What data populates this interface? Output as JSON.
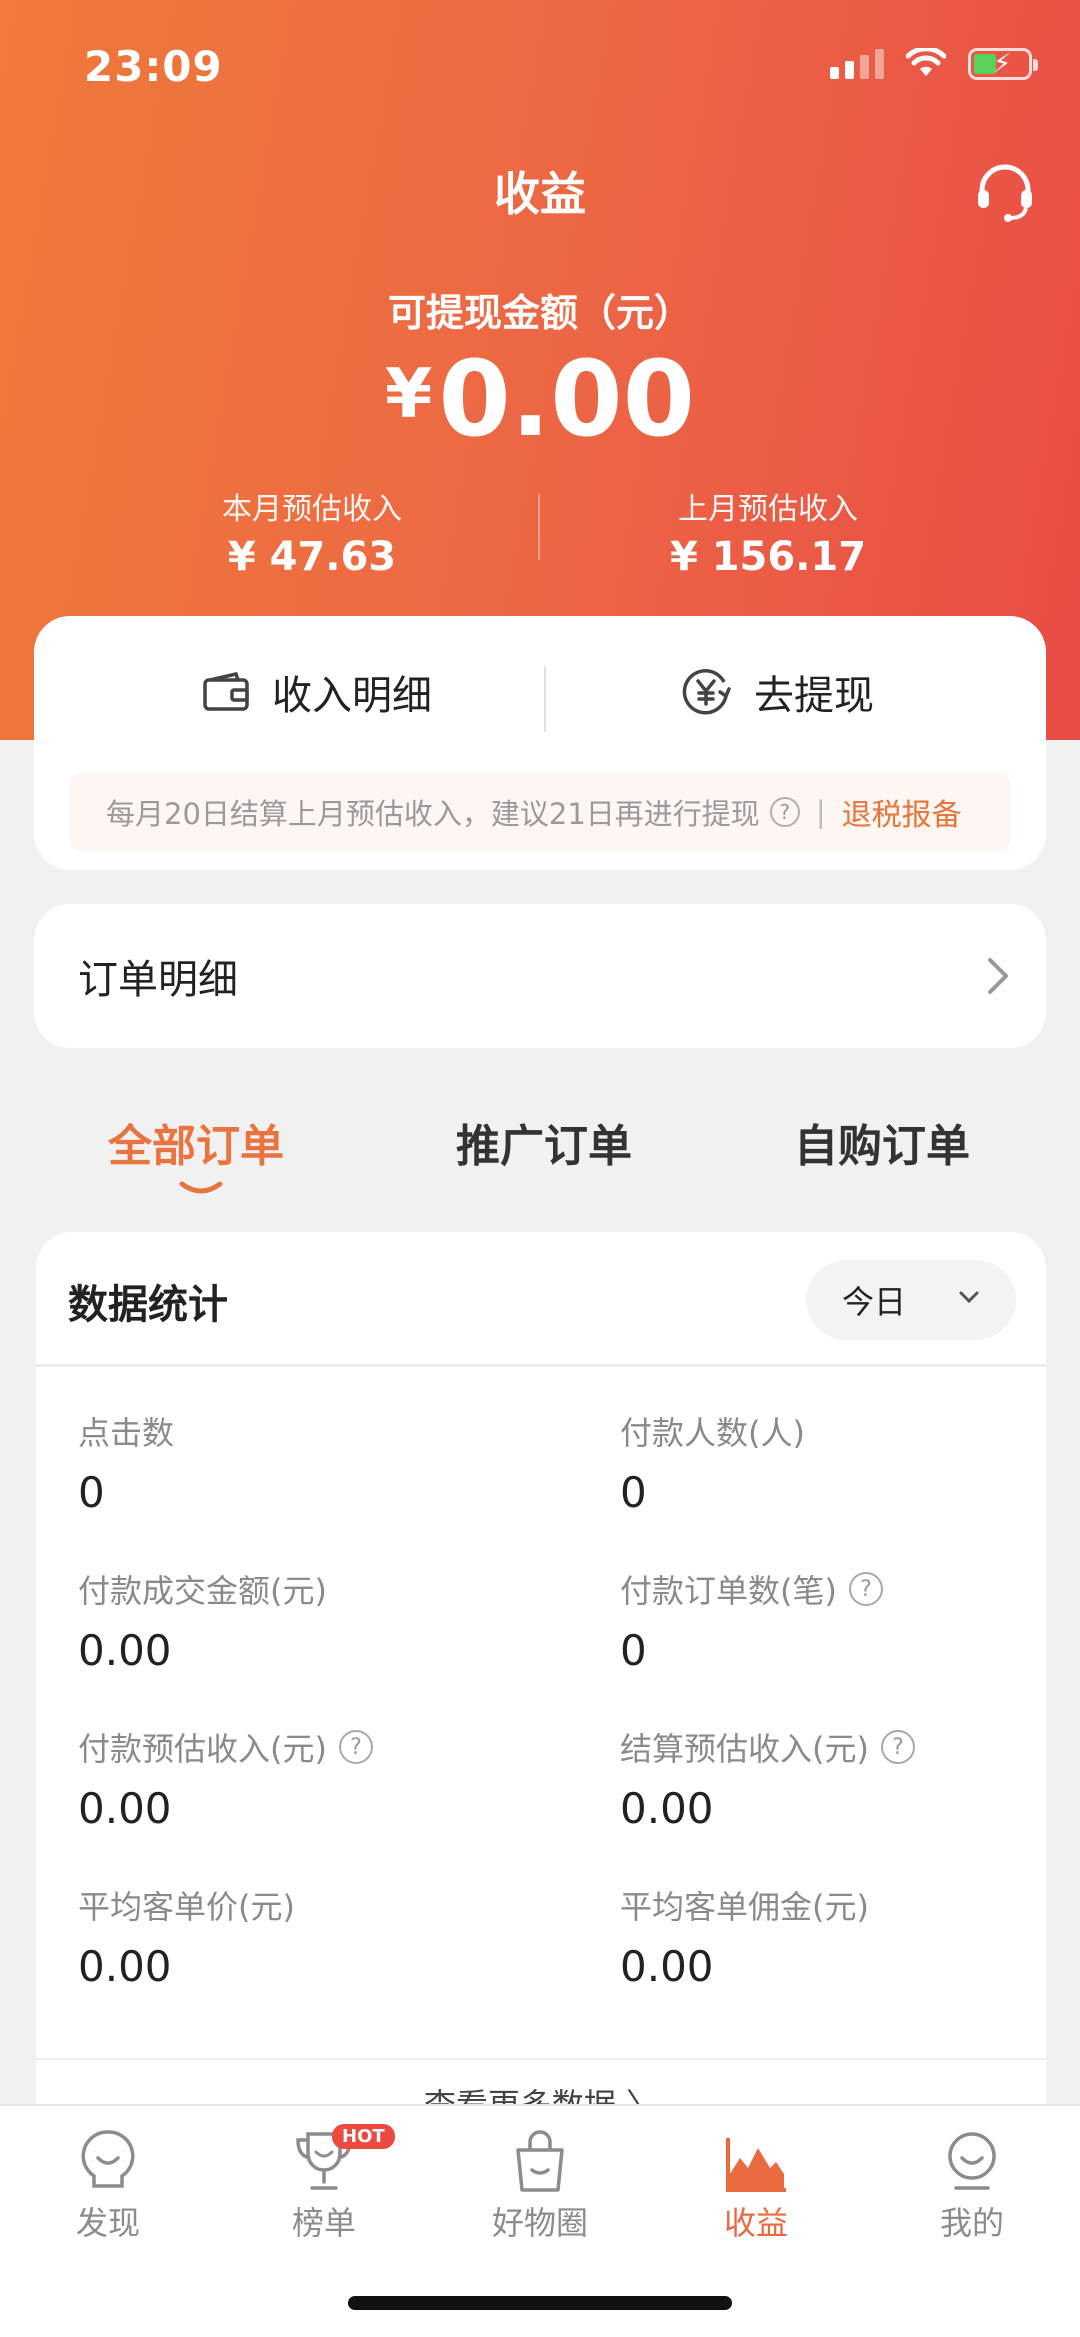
{
  "status_bar": {
    "time": "23:09"
  },
  "header": {
    "title": "收益",
    "balance_label": "可提现金额（元）",
    "currency": "¥",
    "balance_value": "0.00",
    "this_month": {
      "label": "本月预估收入",
      "value": "¥ 47.63"
    },
    "last_month": {
      "label": "上月预估收入",
      "value": "¥ 156.17"
    }
  },
  "actions": {
    "income_detail": "收入明细",
    "withdraw": "去提现",
    "notice": "每月20日结算上月预估收入，建议21日再进行提现",
    "notice_separator": "|",
    "tax_link": "退税报备"
  },
  "order_detail": {
    "label": "订单明细"
  },
  "order_tabs": [
    {
      "label": "全部订单",
      "active": true
    },
    {
      "label": "推广订单",
      "active": false
    },
    {
      "label": "自购订单",
      "active": false
    }
  ],
  "stats": {
    "title": "数据统计",
    "period": "今日",
    "metrics": [
      {
        "label": "点击数",
        "value": "0",
        "help": false
      },
      {
        "label": "付款人数(人)",
        "value": "0",
        "help": false
      },
      {
        "label": "付款成交金额(元)",
        "value": "0.00",
        "help": false
      },
      {
        "label": "付款订单数(笔)",
        "value": "0",
        "help": true
      },
      {
        "label": "付款预估收入(元)",
        "value": "0.00",
        "help": true
      },
      {
        "label": "结算预估收入(元)",
        "value": "0.00",
        "help": true
      },
      {
        "label": "平均客单价(元)",
        "value": "0.00",
        "help": false
      },
      {
        "label": "平均客单佣金(元)",
        "value": "0.00",
        "help": false
      }
    ],
    "more_link": "查看更多数据 〉",
    "help_glyph": "?"
  },
  "tabbar": {
    "items": [
      {
        "label": "发现",
        "icon": "bulb-face-icon",
        "active": false
      },
      {
        "label": "榜单",
        "icon": "trophy-icon",
        "active": false,
        "badge": "HOT"
      },
      {
        "label": "好物圈",
        "icon": "shopping-bag-icon",
        "active": false
      },
      {
        "label": "收益",
        "icon": "chart-area-icon",
        "active": true
      },
      {
        "label": "我的",
        "icon": "profile-face-icon",
        "active": false
      }
    ]
  },
  "colors": {
    "brand_orange": "#ea7440",
    "header_gradient_start": "#ef7a3a",
    "header_gradient_end": "#e94c45",
    "hot_badge": "#ec4a41"
  }
}
